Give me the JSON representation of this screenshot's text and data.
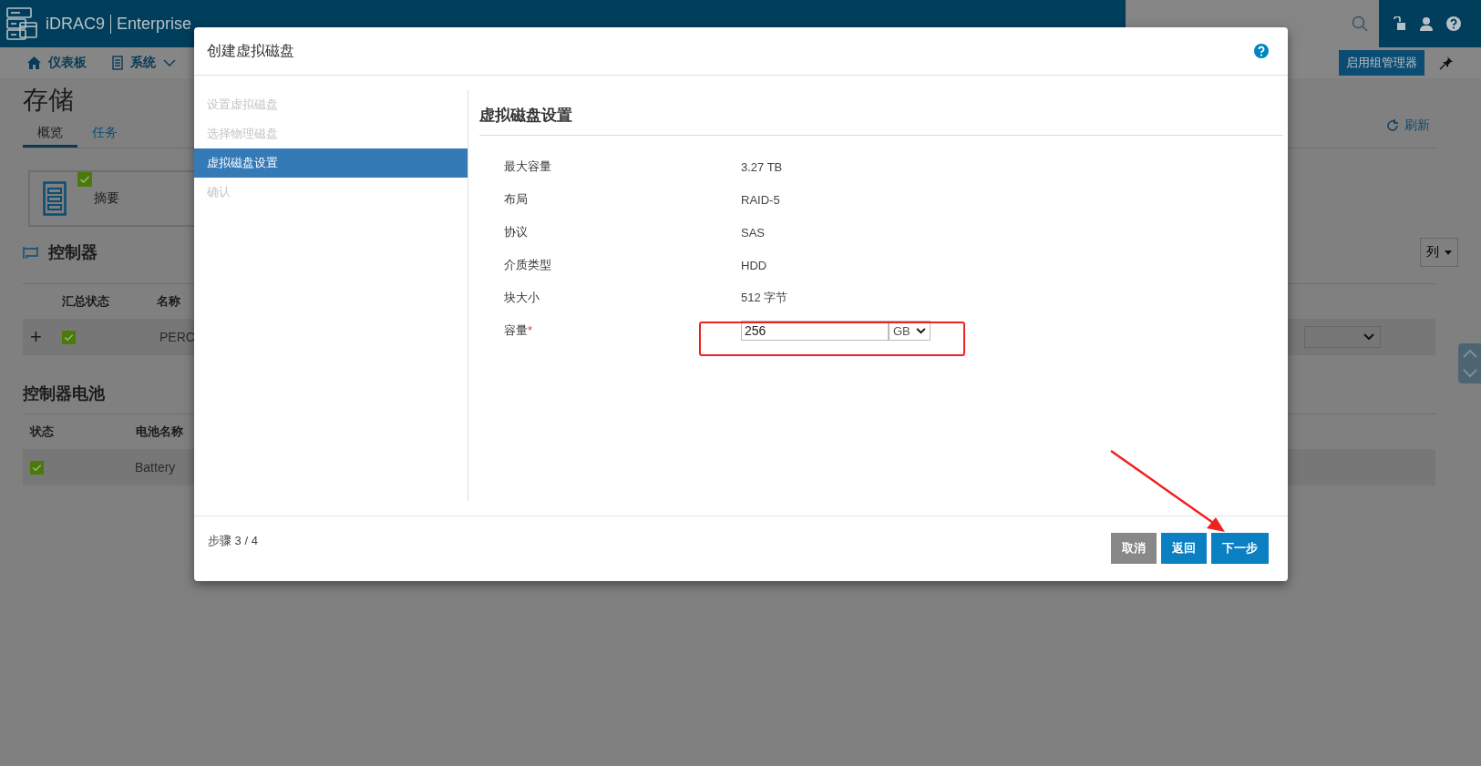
{
  "header": {
    "product": "iDRAC9",
    "edition": "Enterprise"
  },
  "nav": [
    {
      "label": "仪表板",
      "kind": "home"
    },
    {
      "label": "系统",
      "kind": "menu"
    }
  ],
  "group_manager_button": "启用组管理器",
  "page": {
    "title": "存储",
    "tabs": [
      {
        "label": "概览",
        "selected": true
      },
      {
        "label": "任务",
        "selected": false
      }
    ],
    "refresh": "刷新",
    "summary": {
      "label": "摘要"
    },
    "controllers": {
      "title": "控制器",
      "columns_button": "列",
      "columns": [
        "汇总状态",
        "名称"
      ],
      "rows": [
        {
          "expand": "+",
          "name": "PERC"
        }
      ]
    },
    "batteries": {
      "title": "控制器电池",
      "columns": [
        "状态",
        "电池名称"
      ],
      "rows": [
        {
          "name": "Battery"
        }
      ]
    }
  },
  "dialog": {
    "title": "创建虚拟磁盘",
    "steps": [
      {
        "label": "设置虚拟磁盘",
        "selected": false
      },
      {
        "label": "选择物理磁盘",
        "selected": false
      },
      {
        "label": "虚拟磁盘设置",
        "selected": true
      },
      {
        "label": "确认",
        "selected": false
      }
    ],
    "section_title": "虚拟磁盘设置",
    "fields": [
      {
        "label": "最大容量",
        "value": "3.27 TB"
      },
      {
        "label": "布局",
        "value": "RAID-5"
      },
      {
        "label": "协议",
        "value": "SAS"
      },
      {
        "label": "介质类型",
        "value": "HDD"
      },
      {
        "label": "块大小",
        "value": "512 字节"
      }
    ],
    "capacity": {
      "label": "容量",
      "required_mark": "*",
      "value": "256",
      "unit": "GB"
    },
    "step_counter": "步骤 3 / 4",
    "buttons": [
      {
        "label": "取消",
        "kind": "secondary"
      },
      {
        "label": "返回",
        "kind": "primary"
      },
      {
        "label": "下一步",
        "kind": "primary"
      }
    ]
  }
}
